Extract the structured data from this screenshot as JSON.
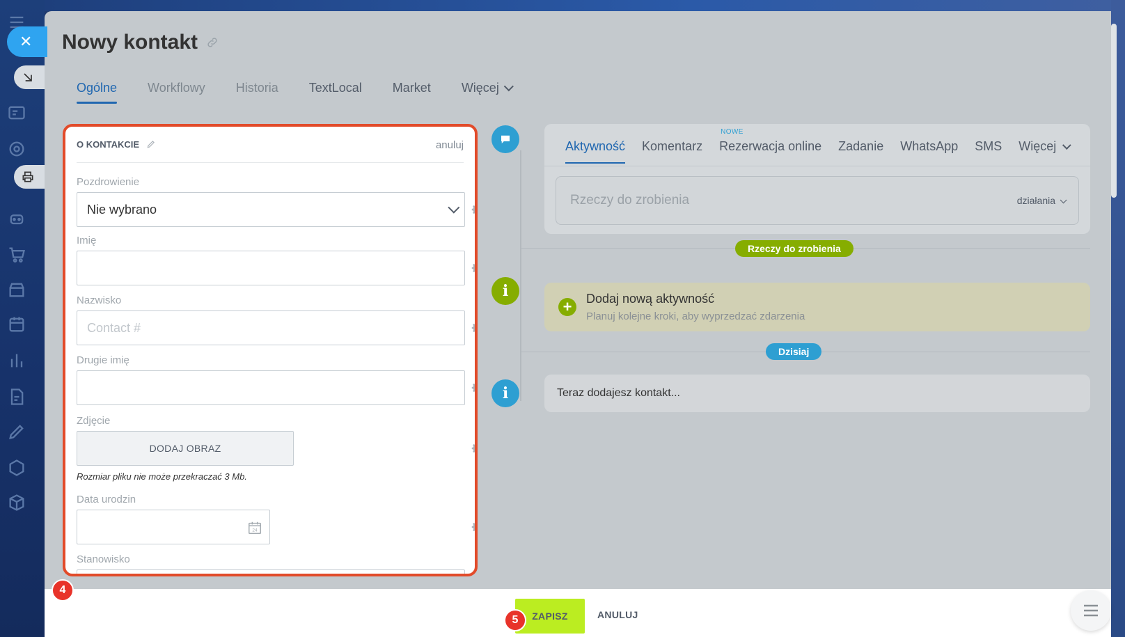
{
  "window": {
    "title": "Nowy kontakt"
  },
  "tabs": [
    {
      "label": "Ogólne",
      "state": "active"
    },
    {
      "label": "Workflowy",
      "state": "faded"
    },
    {
      "label": "Historia",
      "state": "faded"
    },
    {
      "label": "TextLocal",
      "state": "normal"
    },
    {
      "label": "Market",
      "state": "normal"
    },
    {
      "label": "Więcej",
      "state": "normal"
    }
  ],
  "card": {
    "title": "O KONTAKCIE",
    "cancel_label": "anuluj",
    "fields": {
      "salutation": {
        "label": "Pozdrowienie",
        "value": "Nie wybrano"
      },
      "first_name": {
        "label": "Imię",
        "value": ""
      },
      "last_name": {
        "label": "Nazwisko",
        "placeholder": "Contact #"
      },
      "middle_name": {
        "label": "Drugie imię",
        "value": ""
      },
      "photo": {
        "label": "Zdjęcie",
        "button": "DODAJ OBRAZ",
        "note": "Rozmiar pliku nie może przekraczać 3 Mb."
      },
      "birthday": {
        "label": "Data urodzin",
        "value": ""
      },
      "position": {
        "label": "Stanowisko"
      }
    }
  },
  "timeline": {
    "editor_tabs": [
      {
        "label": "Aktywność",
        "active": true
      },
      {
        "label": "Komentarz"
      },
      {
        "label": "Rezerwacja online",
        "badge": "NOWE"
      },
      {
        "label": "Zadanie"
      },
      {
        "label": "WhatsApp"
      },
      {
        "label": "SMS"
      },
      {
        "label": "Więcej"
      }
    ],
    "todo_placeholder": "Rzeczy do zrobienia",
    "actions_label": "działania",
    "todo_pill": "Rzeczy do zrobienia",
    "add_activity_title": "Dodaj nową aktywność",
    "add_activity_sub": "Planuj kolejne kroki, aby wyprzedzać zdarzenia",
    "today_pill": "Dzisiaj",
    "now_text": "Teraz dodajesz kontakt..."
  },
  "footer": {
    "save_label": "ZAPISZ",
    "cancel_label": "ANULUJ"
  },
  "annotations": {
    "badge_card": "4",
    "badge_save": "5"
  },
  "colors": {
    "accent": "#2067b0",
    "save": "#bbed21",
    "highlight": "#e24b2a",
    "timeline_blue": "#2e9fd2",
    "timeline_green": "#86ad00"
  }
}
